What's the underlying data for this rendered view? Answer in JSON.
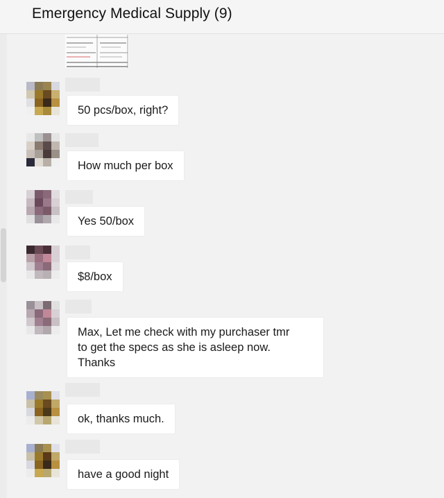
{
  "chat": {
    "title": "Emergency Medical Supply (9)"
  },
  "colors": {
    "background": "#f2f2f2",
    "bubble": "#ffffff",
    "header": "#f5f5f5"
  },
  "messages": [
    {
      "text": "50 pcs/box, right?",
      "avatar": "blurred"
    },
    {
      "text": "How much per box",
      "avatar": "blurred"
    },
    {
      "text": "Yes 50/box",
      "avatar": "blurred"
    },
    {
      "text": "$8/box",
      "avatar": "blurred"
    },
    {
      "text": "Max, Let me check with my purchaser tmr\nto get the specs as she is asleep now.\nThanks",
      "avatar": "blurred"
    },
    {
      "text": "ok, thanks much.",
      "avatar": "blurred"
    },
    {
      "text": "have a good night",
      "avatar": "blurred"
    }
  ]
}
